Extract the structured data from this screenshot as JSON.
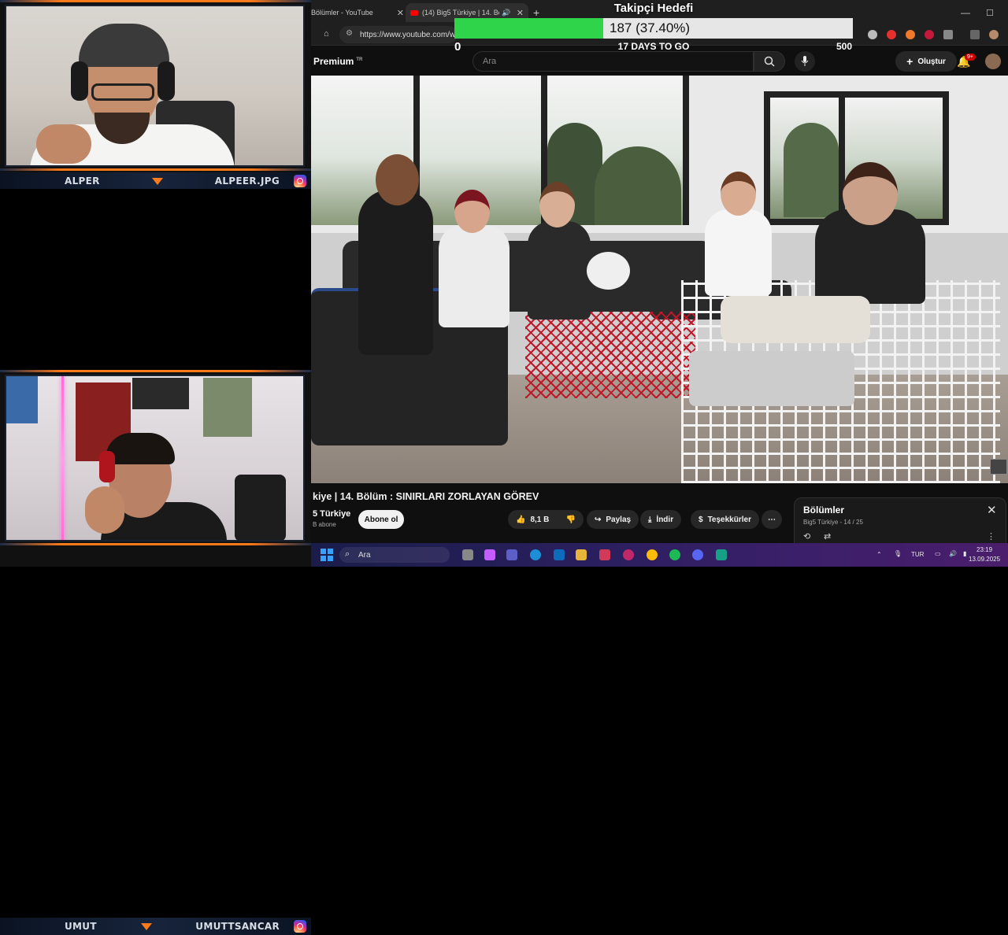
{
  "webcams": {
    "top": {
      "left_label": "ALPER",
      "right_label": "ALPEER.JPG"
    },
    "bottom": {
      "left_label": "UMUT",
      "right_label": "UMUTTSANCAR"
    }
  },
  "browser": {
    "tabs": [
      {
        "label": "Bölümler - YouTube",
        "active": false
      },
      {
        "label": "(14) Big5 Türkiye | 14. Bölüm",
        "active": true
      }
    ],
    "url": "https://www.youtube.com/w"
  },
  "youtube": {
    "logo_text": "Premium",
    "logo_sup": "TR",
    "search_placeholder": "Ara",
    "create_label": "Oluştur",
    "notif_count": "9+",
    "video_title": "kiye | 14. Bölüm : SINIRLARI ZORLAYAN GÖREV",
    "channel_name": "5 Türkiye",
    "channel_subs": "B abone",
    "subscribe_label": "Abone ol",
    "like_count": "8,1 B",
    "share_label": "Paylaş",
    "download_label": "İndir",
    "thanks_label": "Teşekkürler",
    "playlist": {
      "title": "Bölümler",
      "subtitle": "Big5 Türkiye - 14 / 25"
    }
  },
  "goal": {
    "title": "Takipçi Hedefi",
    "current_text": "187 (37.40%)",
    "progress": 0.374,
    "min": "0",
    "max": "500",
    "days_left": "17 DAYS TO GO"
  },
  "taskbar": {
    "search_placeholder": "Ara",
    "lang": "TUR",
    "time": "23:19",
    "date": "13.09.2025"
  },
  "colors": {
    "accent_orange": "#ff7a1a",
    "goal_green": "#2fd44a",
    "yt_red": "#ff0000"
  }
}
